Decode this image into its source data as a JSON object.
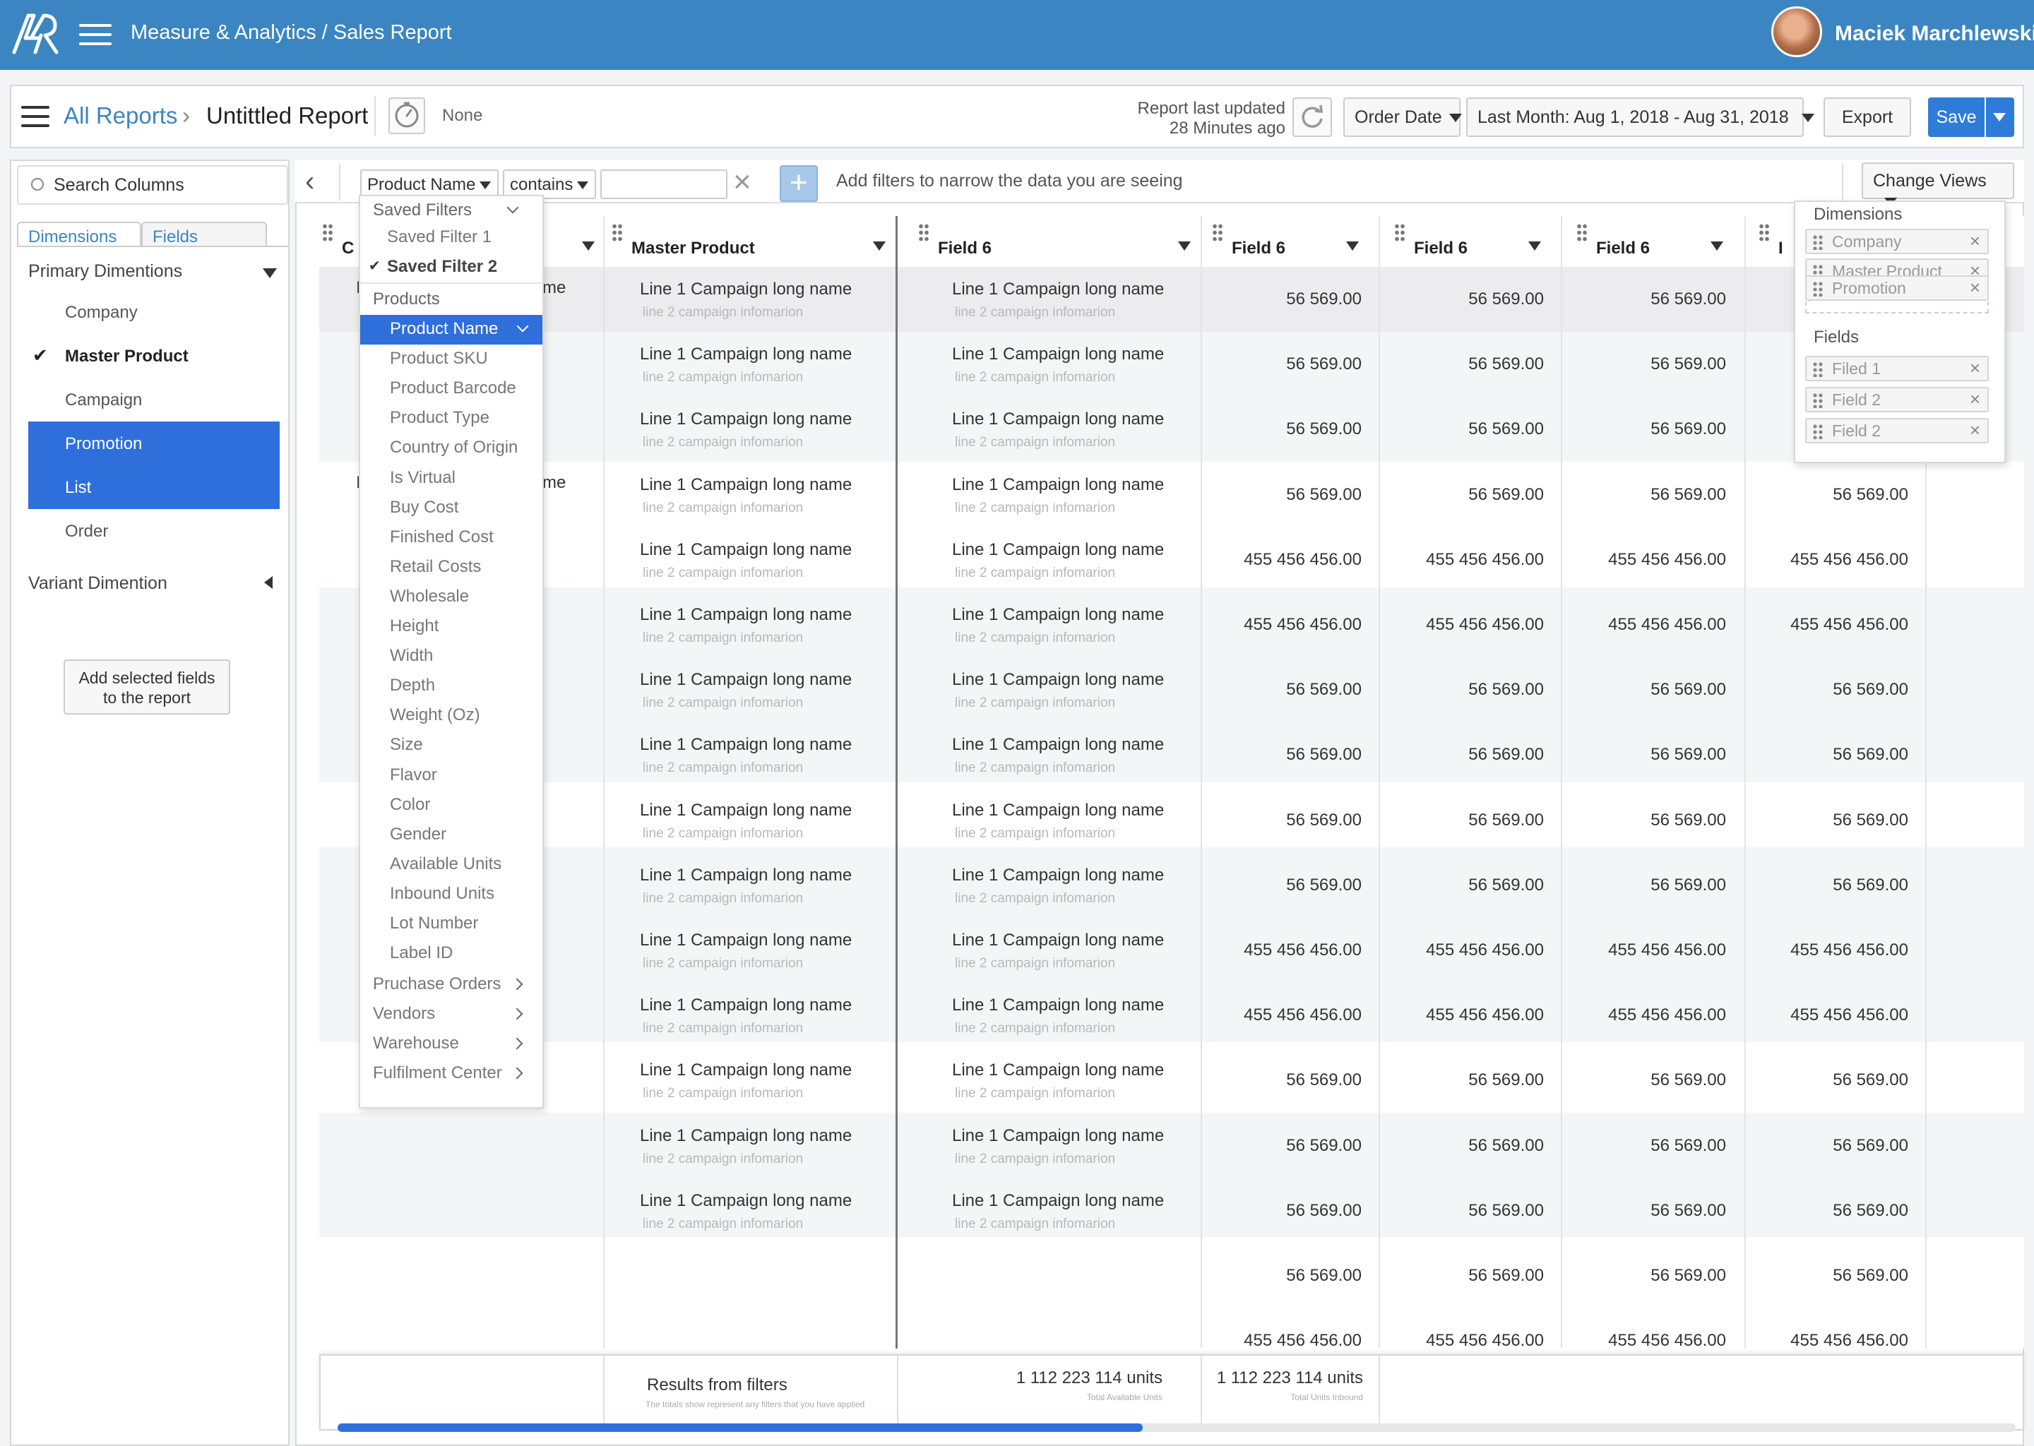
{
  "topbar": {
    "title": "Measure & Analytics / Sales Report",
    "user_name": "Maciek Marchlewski"
  },
  "report": {
    "breadcrumb_root": "All Reports",
    "breadcrumb_sep": "›",
    "title": "Untittled Report",
    "schedule": "None",
    "updated_line1": "Report last updated",
    "updated_line2": "28 Minutes ago",
    "date_field": "Order Date",
    "date_range": "Last Month: Aug 1, 2018 - Aug 31, 2018",
    "export_label": "Export",
    "save_label": "Save"
  },
  "left_panel": {
    "search_placeholder": "Search Columns",
    "tab_dimensions": "Dimensions",
    "tab_fields": "Fields",
    "primary_heading": "Primary Dimentions",
    "items": [
      "Company",
      "Master Product",
      "Campaign",
      "Promotion",
      "List",
      "Order"
    ],
    "checked_item": "Master Product",
    "selected_items": [
      "Promotion",
      "List"
    ],
    "variant_heading": "Variant Dimention",
    "add_button_line1": "Add selected fields",
    "add_button_line2": "to the report"
  },
  "filter_bar": {
    "field": "Product Name",
    "operator": "contains",
    "value": "",
    "hint": "Add filters to narrow the data you are seeing",
    "change_views": "Change Views"
  },
  "field_menu": {
    "saved_heading": "Saved Filters",
    "saved_items": [
      "Saved Filter 1",
      "Saved Filter 2"
    ],
    "saved_checked": "Saved Filter 2",
    "products_heading": "Products",
    "products_items": [
      "Product Name",
      "Product SKU",
      "Product Barcode",
      "Product Type",
      "Country of Origin",
      "Is Virtual",
      "Buy Cost",
      "Finished Cost",
      "Retail Costs",
      "Wholesale",
      "Height",
      "Width",
      "Depth",
      "Weight (Oz)",
      "Size",
      "Flavor",
      "Color",
      "Gender",
      "Available Units",
      "Inbound Units",
      "Lot Number",
      "Label ID"
    ],
    "selected_item": "Product Name",
    "groups": [
      "Pruchase Orders",
      "Vendors",
      "Warehouse",
      "Fulfilment Center"
    ]
  },
  "views_panel": {
    "dimensions_heading": "Dimensions",
    "dimension_chips": [
      "Company",
      "Master Product",
      "Promotion"
    ],
    "fields_heading": "Fields",
    "field_chips": [
      "Filed 1",
      "Field 2",
      "Field 2"
    ]
  },
  "grid": {
    "columns": [
      "C",
      "Master Product",
      "Field 6",
      "Field 6",
      "Field 6",
      "Field 6",
      "I"
    ],
    "first_col_fragments": [
      "I",
      "me",
      "I",
      "me"
    ],
    "rows": [
      {
        "name": "Line 1 Campaign long name",
        "sub": "line 2 campaign infomarion",
        "values": [
          "56 569.00",
          "56 569.00",
          "56 569.00",
          ""
        ]
      },
      {
        "name": "Line 1 Campaign long name",
        "sub": "line 2 campaign infomarion",
        "values": [
          "56 569.00",
          "56 569.00",
          "56 569.00",
          ""
        ]
      },
      {
        "name": "Line 1 Campaign long name",
        "sub": "line 2 campaign infomarion",
        "values": [
          "56 569.00",
          "56 569.00",
          "56 569.00",
          ""
        ]
      },
      {
        "name": "Line 1 Campaign long name",
        "sub": "line 2 campaign infomarion",
        "values": [
          "56 569.00",
          "56 569.00",
          "56 569.00",
          "56 569.00"
        ]
      },
      {
        "name": "Line 1 Campaign long name",
        "sub": "line 2 campaign infomarion",
        "values": [
          "455 456 456.00",
          "455 456 456.00",
          "455 456 456.00",
          "455 456 456.00"
        ]
      },
      {
        "name": "Line 1 Campaign long name",
        "sub": "line 2 campaign infomarion",
        "values": [
          "455 456 456.00",
          "455 456 456.00",
          "455 456 456.00",
          "455 456 456.00"
        ]
      },
      {
        "name": "Line 1 Campaign long name",
        "sub": "line 2 campaign infomarion",
        "values": [
          "56 569.00",
          "56 569.00",
          "56 569.00",
          "56 569.00"
        ]
      },
      {
        "name": "Line 1 Campaign long name",
        "sub": "line 2 campaign infomarion",
        "values": [
          "56 569.00",
          "56 569.00",
          "56 569.00",
          "56 569.00"
        ]
      },
      {
        "name": "Line 1 Campaign long name",
        "sub": "line 2 campaign infomarion",
        "values": [
          "56 569.00",
          "56 569.00",
          "56 569.00",
          "56 569.00"
        ]
      },
      {
        "name": "Line 1 Campaign long name",
        "sub": "line 2 campaign infomarion",
        "values": [
          "56 569.00",
          "56 569.00",
          "56 569.00",
          "56 569.00"
        ]
      },
      {
        "name": "Line 1 Campaign long name",
        "sub": "line 2 campaign infomarion",
        "values": [
          "455 456 456.00",
          "455 456 456.00",
          "455 456 456.00",
          "455 456 456.00"
        ]
      },
      {
        "name": "Line 1 Campaign long name",
        "sub": "line 2 campaign infomarion",
        "values": [
          "455 456 456.00",
          "455 456 456.00",
          "455 456 456.00",
          "455 456 456.00"
        ]
      },
      {
        "name": "Line 1 Campaign long name",
        "sub": "line 2 campaign infomarion",
        "values": [
          "56 569.00",
          "56 569.00",
          "56 569.00",
          "56 569.00"
        ]
      },
      {
        "name": "Line 1 Campaign long name",
        "sub": "line 2 campaign infomarion",
        "values": [
          "56 569.00",
          "56 569.00",
          "56 569.00",
          "56 569.00"
        ]
      },
      {
        "name": "Line 1 Campaign long name",
        "sub": "line 2 campaign infomarion",
        "values": [
          "56 569.00",
          "56 569.00",
          "56 569.00",
          "56 569.00"
        ]
      },
      {
        "name": "",
        "sub": "",
        "values": [
          "56 569.00",
          "56 569.00",
          "56 569.00",
          "56 569.00"
        ]
      },
      {
        "name": "",
        "sub": "",
        "values": [
          "455 456 456.00",
          "455 456 456.00",
          "455 456 456.00",
          "455 456 456.00"
        ]
      }
    ]
  },
  "footer": {
    "label": "Results from filters",
    "note": "The totals show represent any filters that you have applied",
    "total1": "1 112 223 114 units",
    "total1_sub": "Total Available Units",
    "total2": "1 112 223 114 units",
    "total2_sub": "Total Units Inbound",
    "scroll_fraction": 0.48
  },
  "colors": {
    "brand": "#3b86c2",
    "selection": "#2e6fdc",
    "save": "#2f7bd8"
  }
}
